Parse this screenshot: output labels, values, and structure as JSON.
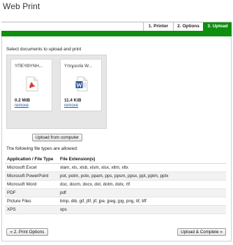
{
  "app": {
    "title": "Web Print"
  },
  "tabs": [
    {
      "label": "1. Printer",
      "active": false
    },
    {
      "label": "2. Options",
      "active": false
    },
    {
      "label": "3. Upload",
      "active": true
    }
  ],
  "colors": {
    "accent": "#0e8f0e",
    "link": "#1f5bb5",
    "pdf_icon": "#e03b2f",
    "word_icon": "#2b5797"
  },
  "upload": {
    "instruction": "Select documents to upload and print",
    "files": [
      {
        "name": "ΥΠΕΥΘΥΝΗ...",
        "icon": "pdf-file-icon",
        "size": "0.2",
        "unit": "MiB",
        "remove_label": "remove"
      },
      {
        "name": "Υπηρεσία W...",
        "icon": "word-file-icon",
        "size": "11.4",
        "unit": "KiB",
        "remove_label": "remove"
      }
    ],
    "upload_button_label": "Upload from computer"
  },
  "file_types": {
    "heading": "The following file types are allowed:",
    "columns": [
      "Application / File Type",
      "File Extension(s)"
    ],
    "rows": [
      [
        "Microsoft Excel",
        "xlam, xls, xlsb, xlsm, xlsx, xltm, xltx"
      ],
      [
        "Microsoft PowerPoint",
        "pot, potm, potx, ppam, pps, ppsm, ppsx, ppt, pptm, pptx"
      ],
      [
        "Microsoft Word",
        "doc, docm, docx, dot, dotm, dotx, rtf"
      ],
      [
        "PDF",
        "pdf"
      ],
      [
        "Picture Files",
        "bmp, dib, gif, jfif, jif, jpe, jpeg, jpg, png, tif, tiff"
      ],
      [
        "XPS",
        "xps"
      ]
    ]
  },
  "nav": {
    "prev_label": "« 2. Print Options",
    "next_label": "Upload & Complete »"
  }
}
